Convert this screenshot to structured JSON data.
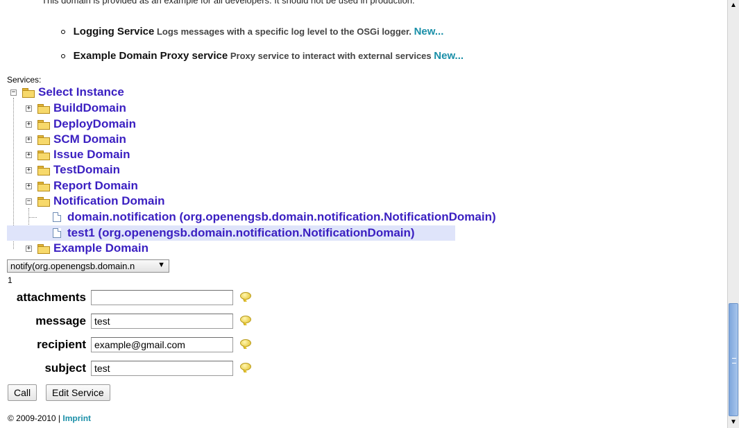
{
  "header": {
    "clipped_text": "This domain is provided as an example for all developers. It should not be used in production."
  },
  "bullets": [
    {
      "name": "Logging Service",
      "desc": "Logs messages with a specific log level to the OSGi logger.",
      "link": "New..."
    },
    {
      "name": "Example Domain Proxy service",
      "desc": "Proxy service to interact with external services",
      "link": "New..."
    }
  ],
  "services_label": "Services:",
  "tree": {
    "root": "Select Instance",
    "domains": [
      "BuildDomain",
      "DeployDomain",
      "SCM Domain",
      "Issue Domain",
      "TestDomain",
      "Report Domain",
      "Notification Domain"
    ],
    "notification_children": [
      "domain.notification (org.openengsb.domain.notification.NotificationDomain)",
      "test1 (org.openengsb.domain.notification.NotificationDomain)"
    ],
    "last_domain": "Example Domain"
  },
  "method_select": {
    "value": "notify(org.openengsb.domain.n",
    "arrow": "▼"
  },
  "param_count": "1",
  "params": [
    {
      "label": "attachments",
      "value": ""
    },
    {
      "label": "message",
      "value": "test"
    },
    {
      "label": "recipient",
      "value": "example@gmail.com"
    },
    {
      "label": "subject",
      "value": "test"
    }
  ],
  "buttons": {
    "call": "Call",
    "edit": "Edit Service"
  },
  "footer": {
    "copyright": "© 2009-2010 |",
    "imprint": "Imprint"
  },
  "scrollbar": {
    "up": "▲",
    "down": "▼"
  }
}
